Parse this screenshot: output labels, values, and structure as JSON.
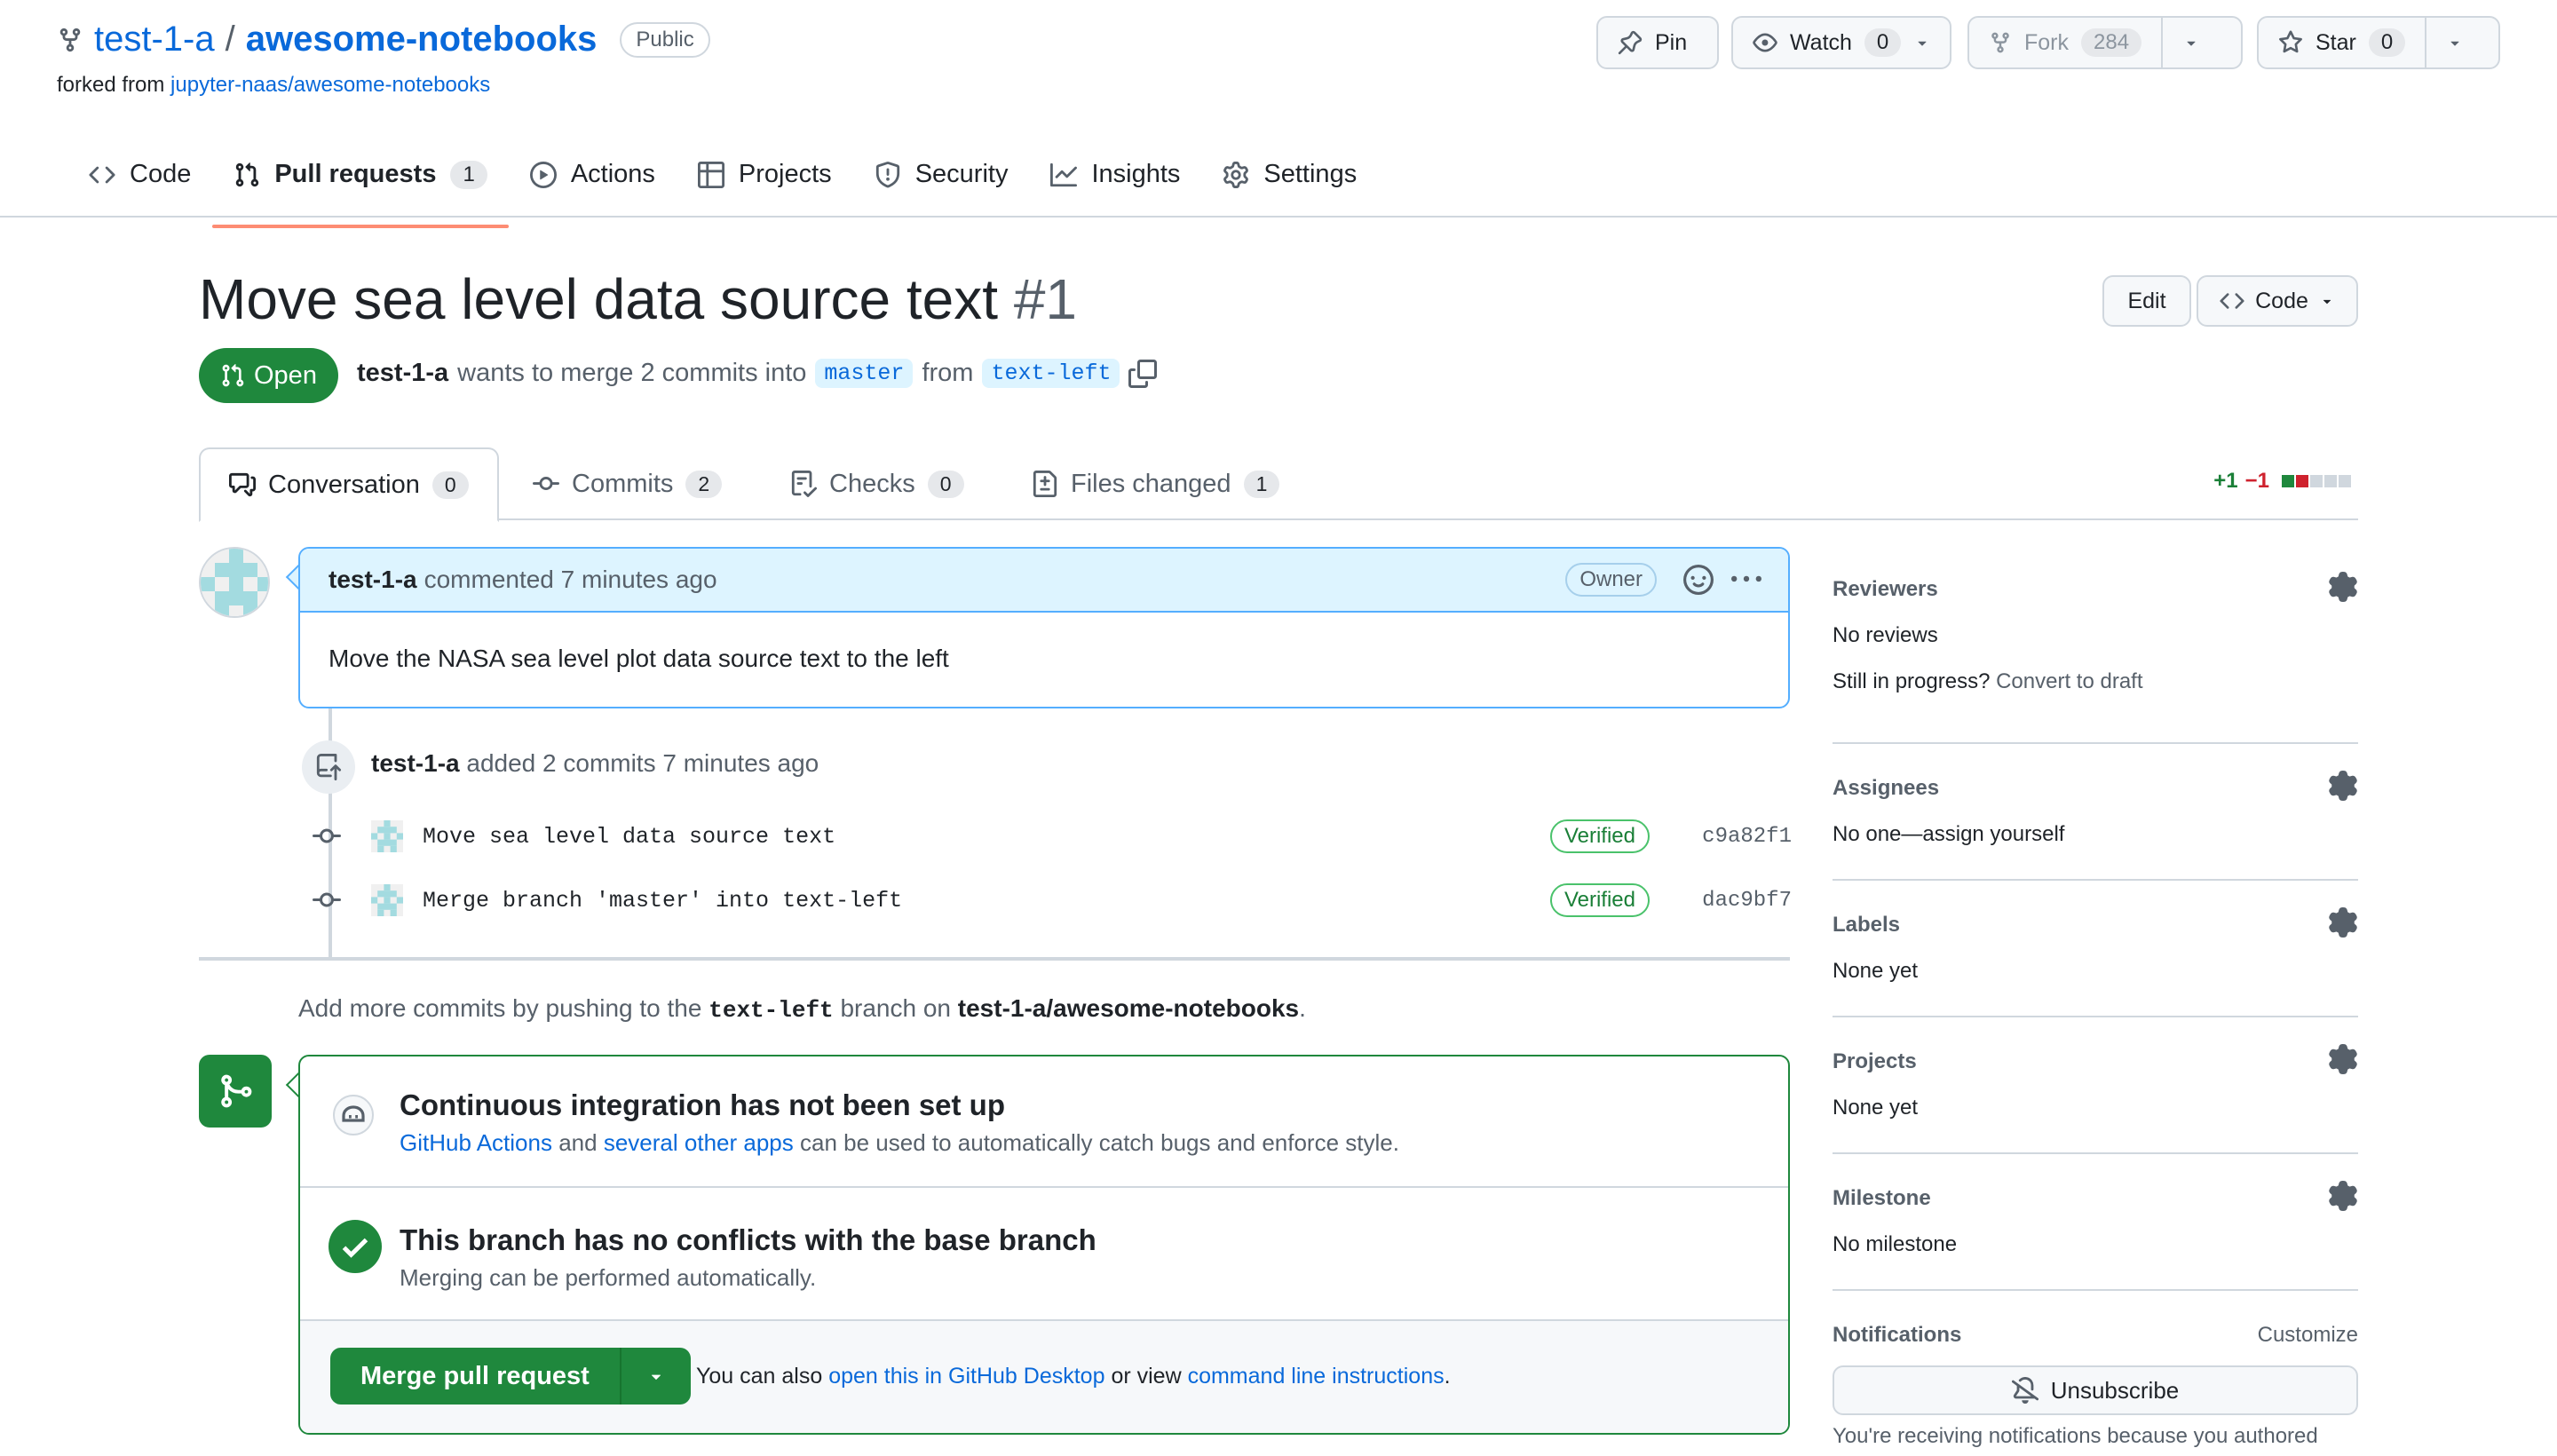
{
  "repo": {
    "owner": "test-1-a",
    "separator": "/",
    "name": "awesome-notebooks",
    "visibility": "Public",
    "forked_prefix": "forked from",
    "forked_from": "jupyter-naas/awesome-notebooks"
  },
  "header_buttons": {
    "pin": "Pin",
    "watch": "Watch",
    "watch_count": "0",
    "fork": "Fork",
    "fork_count": "284",
    "star": "Star",
    "star_count": "0"
  },
  "nav_tabs": {
    "code": "Code",
    "pull_requests": "Pull requests",
    "pull_requests_count": "1",
    "actions": "Actions",
    "projects": "Projects",
    "security": "Security",
    "insights": "Insights",
    "settings": "Settings"
  },
  "pr": {
    "title": "Move sea level data source text",
    "number": "#1",
    "edit_label": "Edit",
    "code_label": "Code",
    "state": "Open",
    "author": "test-1-a",
    "meta_text": "wants to merge 2 commits into",
    "base_branch": "master",
    "from_text": "from",
    "head_branch": "text-left"
  },
  "pr_tabs": {
    "conversation": "Conversation",
    "conversation_count": "0",
    "commits": "Commits",
    "commits_count": "2",
    "checks": "Checks",
    "checks_count": "0",
    "files_changed": "Files changed",
    "files_changed_count": "1",
    "additions": "+1",
    "deletions": "−1"
  },
  "comment": {
    "author": "test-1-a",
    "action": "commented 7 minutes ago",
    "badge": "Owner",
    "body": "Move the NASA sea level plot data source text to the left"
  },
  "commits_event": {
    "author": "test-1-a",
    "text": "added 2 commits 7 minutes ago",
    "items": [
      {
        "message": "Move sea level data source text",
        "verified": "Verified",
        "sha": "c9a82f1"
      },
      {
        "message": "Merge branch 'master' into text-left",
        "verified": "Verified",
        "sha": "dac9bf7"
      }
    ]
  },
  "hint": {
    "prefix": "Add more commits by pushing to the",
    "branch": "text-left",
    "middle": "branch on",
    "repo": "test-1-a/awesome-notebooks",
    "suffix": "."
  },
  "merge": {
    "ci_title": "Continuous integration has not been set up",
    "ci_link1": "GitHub Actions",
    "ci_and": "and",
    "ci_link2": "several other apps",
    "ci_rest": "can be used to automatically catch bugs and enforce style.",
    "conflict_title": "This branch has no conflicts with the base branch",
    "conflict_sub": "Merging can be performed automatically.",
    "merge_button": "Merge pull request",
    "also_prefix": "You can also",
    "also_link1": "open this in GitHub Desktop",
    "also_mid": "or view",
    "also_link2": "command line instructions",
    "also_suffix": "."
  },
  "sidebar": {
    "reviewers": "Reviewers",
    "reviewers_value": "No reviews",
    "in_progress": "Still in progress?",
    "convert": "Convert to draft",
    "assignees": "Assignees",
    "assignees_value": "No one—assign yourself",
    "labels": "Labels",
    "labels_value": "None yet",
    "projects": "Projects",
    "projects_value": "None yet",
    "milestone": "Milestone",
    "milestone_value": "No milestone",
    "notifications": "Notifications",
    "customize": "Customize",
    "unsubscribe": "Unsubscribe",
    "reason": "You're receiving notifications because you authored"
  },
  "colors": {
    "accent": "#0969da",
    "open_green": "#1f883d",
    "tab_underline": "#fd8c73",
    "verified": "#1a7f37",
    "deletion": "#cf222e"
  }
}
